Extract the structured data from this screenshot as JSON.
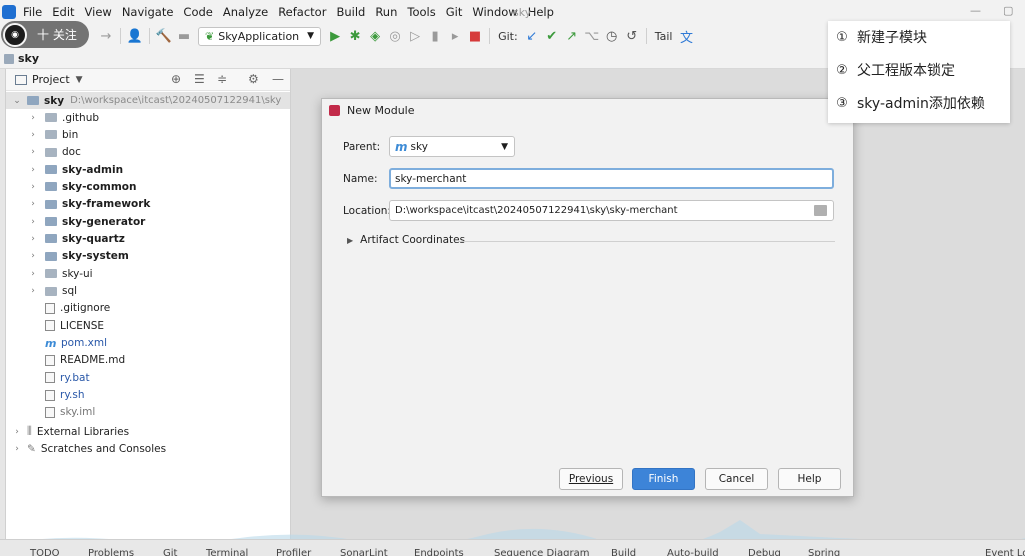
{
  "window": {
    "title": "sky"
  },
  "menu": [
    "File",
    "Edit",
    "View",
    "Navigate",
    "Code",
    "Analyze",
    "Refactor",
    "Build",
    "Run",
    "Tools",
    "Git",
    "Window",
    "Help"
  ],
  "toolbar": {
    "run_config": "SkyApplication",
    "git_label": "Git:",
    "tail_label": "Tail"
  },
  "follow_badge": {
    "text": "十 关注"
  },
  "nav": {
    "project_name": "sky"
  },
  "project_panel": {
    "title": "Project",
    "root": {
      "name": "sky",
      "path": "D:\\workspace\\itcast\\20240507122941\\sky"
    },
    "items": [
      {
        "name": ".github",
        "kind": "folder",
        "bold": false
      },
      {
        "name": "bin",
        "kind": "folder",
        "bold": false
      },
      {
        "name": "doc",
        "kind": "folder",
        "bold": false
      },
      {
        "name": "sky-admin",
        "kind": "module",
        "bold": true
      },
      {
        "name": "sky-common",
        "kind": "module",
        "bold": true
      },
      {
        "name": "sky-framework",
        "kind": "module",
        "bold": true
      },
      {
        "name": "sky-generator",
        "kind": "module",
        "bold": true
      },
      {
        "name": "sky-quartz",
        "kind": "module",
        "bold": true
      },
      {
        "name": "sky-system",
        "kind": "module",
        "bold": true
      },
      {
        "name": "sky-ui",
        "kind": "folder",
        "bold": false
      },
      {
        "name": "sql",
        "kind": "folder",
        "bold": false
      },
      {
        "name": ".gitignore",
        "kind": "file",
        "bold": false
      },
      {
        "name": "LICENSE",
        "kind": "file",
        "bold": false
      },
      {
        "name": "pom.xml",
        "kind": "maven",
        "bold": false
      },
      {
        "name": "README.md",
        "kind": "file",
        "bold": false
      },
      {
        "name": "ry.bat",
        "kind": "file",
        "bold": false
      },
      {
        "name": "ry.sh",
        "kind": "file",
        "bold": false
      },
      {
        "name": "sky.iml",
        "kind": "file",
        "bold": false
      }
    ],
    "external_libraries": "External Libraries",
    "scratches": "Scratches and Consoles"
  },
  "dialog": {
    "title": "New Module",
    "parent_label": "Parent:",
    "parent_value": "sky",
    "name_label": "Name:",
    "name_value": "sky-merchant",
    "location_label": "Location:",
    "location_value": "D:\\workspace\\itcast\\20240507122941\\sky\\sky-merchant",
    "artifact_label": "Artifact Coordinates",
    "buttons": {
      "previous": "Previous",
      "finish": "Finish",
      "cancel": "Cancel",
      "help": "Help"
    }
  },
  "notes": [
    {
      "num": "①",
      "text": "新建子模块"
    },
    {
      "num": "②",
      "text": "父工程版本锁定"
    },
    {
      "num": "③",
      "text": "sky-admin添加依赖"
    }
  ],
  "bottom_bar": [
    "TODO",
    "Problems",
    "Git",
    "Terminal",
    "Profiler",
    "SonarLint",
    "Endpoints",
    "Sequence Diagram",
    "Build",
    "Auto-build",
    "Debug",
    "Spring",
    "Event Log"
  ],
  "colors": {
    "accent": "#3d84d8",
    "run_green": "#3c9a3c",
    "stop_red": "#d63a3a"
  }
}
